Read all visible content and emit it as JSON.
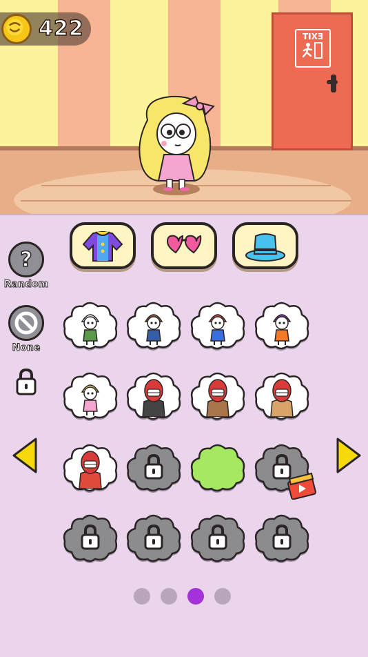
{
  "hud": {
    "coins": "422"
  },
  "scene": {
    "exit_sign": "EXIT"
  },
  "categories": [
    {
      "name": "tab-clothes",
      "icon": "shirt-icon",
      "selected": false
    },
    {
      "name": "tab-glasses",
      "icon": "heart-glasses-icon",
      "selected": false
    },
    {
      "name": "tab-hats",
      "icon": "top-hat-icon",
      "selected": false
    }
  ],
  "side": {
    "random_label": "Random",
    "none_label": "None"
  },
  "colors": {
    "panel_bg": "#ead5ec",
    "tab_bg": "#fff5c4",
    "selected_slot": "#a6e860",
    "locked_slot": "#8c8c8f",
    "active_page_dot": "#a531d9",
    "inactive_page_dot": "#b9a6bd",
    "arrow": "#f5d90a"
  },
  "grid": [
    {
      "id": "chef",
      "state": "unlocked",
      "icon": "chef-character-icon"
    },
    {
      "id": "cowboy",
      "state": "unlocked",
      "icon": "cowboy-character-icon"
    },
    {
      "id": "jester-girl",
      "state": "unlocked",
      "icon": "harley-character-icon"
    },
    {
      "id": "witch",
      "state": "unlocked",
      "icon": "witch-character-icon"
    },
    {
      "id": "blonde-girl",
      "state": "unlocked",
      "icon": "blonde-girl-icon"
    },
    {
      "id": "mime-monster",
      "state": "unlocked",
      "icon": "striped-monster-icon"
    },
    {
      "id": "scarf-monster",
      "state": "unlocked",
      "icon": "scarf-monster-icon"
    },
    {
      "id": "coat-monster",
      "state": "unlocked",
      "icon": "coat-monster-icon"
    },
    {
      "id": "suit-monster",
      "state": "unlocked",
      "icon": "suit-monster-icon"
    },
    {
      "id": "locked-1",
      "state": "locked",
      "icon": "lock-icon"
    },
    {
      "id": "selected-empty",
      "state": "selected",
      "icon": ""
    },
    {
      "id": "locked-video",
      "state": "locked-video",
      "icon": "lock-icon"
    },
    {
      "id": "locked-2",
      "state": "locked",
      "icon": "lock-icon"
    },
    {
      "id": "locked-3",
      "state": "locked",
      "icon": "lock-icon"
    },
    {
      "id": "locked-4",
      "state": "locked",
      "icon": "lock-icon"
    },
    {
      "id": "locked-5",
      "state": "locked",
      "icon": "lock-icon"
    }
  ],
  "pagination": {
    "total": 4,
    "current": 3
  }
}
